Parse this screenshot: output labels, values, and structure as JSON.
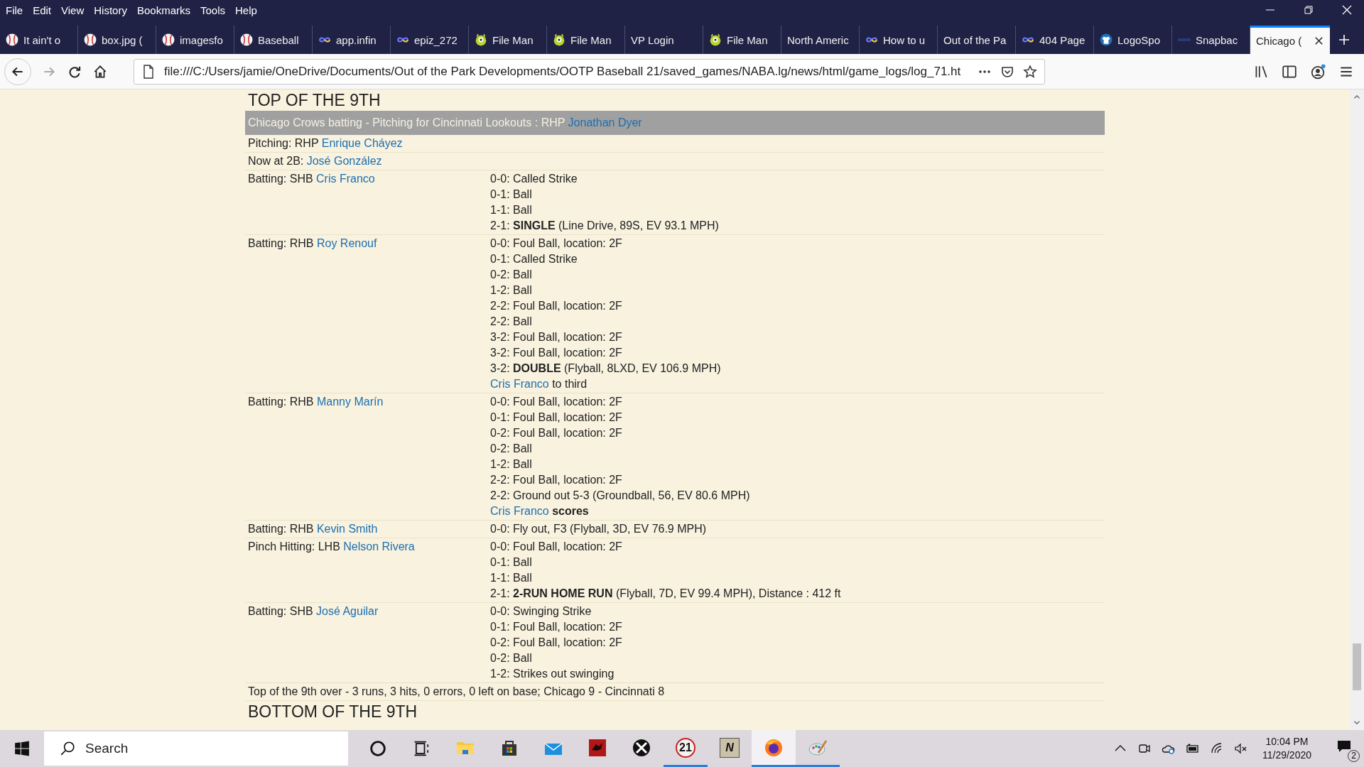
{
  "menu_bar": [
    "File",
    "Edit",
    "View",
    "History",
    "Bookmarks",
    "Tools",
    "Help"
  ],
  "tabs": [
    {
      "label": "It ain't o",
      "kind": "baseball",
      "selected": false
    },
    {
      "label": "box.jpg (",
      "kind": "baseball",
      "selected": false
    },
    {
      "label": "imagesfo",
      "kind": "baseball",
      "selected": false
    },
    {
      "label": "Baseball",
      "kind": "baseball",
      "selected": false
    },
    {
      "label": "app.infin",
      "kind": "infinity",
      "selected": false
    },
    {
      "label": "epiz_272",
      "kind": "infinity",
      "selected": false
    },
    {
      "label": "File Man",
      "kind": "monster",
      "selected": false
    },
    {
      "label": "File Man",
      "kind": "monster",
      "selected": false
    },
    {
      "label": "VP Login",
      "kind": "plain",
      "selected": false
    },
    {
      "label": "File Man",
      "kind": "monster",
      "selected": false
    },
    {
      "label": "North Americ",
      "kind": "plain",
      "selected": false
    },
    {
      "label": "How to u",
      "kind": "infinity",
      "selected": false
    },
    {
      "label": "Out of the Pa",
      "kind": "plain",
      "selected": false
    },
    {
      "label": "404 Page",
      "kind": "infinity",
      "selected": false
    },
    {
      "label": "LogoSpo",
      "kind": "shirt",
      "selected": false
    },
    {
      "label": "Snapbac",
      "kind": "snap",
      "selected": false
    },
    {
      "label": "Chicago (",
      "kind": "plain",
      "selected": true
    }
  ],
  "address_bar": {
    "url": "file:///C:/Users/jamie/OneDrive/Documents/Out of the Park Developments/OOTP Baseball 21/saved_games/NABA.lg/news/html/game_logs/log_71.ht"
  },
  "page": {
    "heading": "TOP OF THE 9TH",
    "banner": {
      "text": "Chicago Crows batting - Pitching for Cincinnati Lookouts : RHP",
      "player": "Jonathan Dyer"
    },
    "rows": [
      {
        "label": "Pitching: RHP",
        "player": "Enrique Cháyez",
        "events": []
      },
      {
        "label": "Now at 2B:",
        "player": "José González",
        "events": []
      },
      {
        "label": "Batting: SHB",
        "player": "Cris Franco",
        "events": [
          {
            "text": "0-0: Called Strike"
          },
          {
            "text": "0-1: Ball"
          },
          {
            "text": "1-1: Ball"
          },
          {
            "text": "2-1: **SINGLE** (Line Drive, 89S, EV 93.1 MPH)"
          }
        ]
      },
      {
        "label": "Batting: RHB",
        "player": "Roy Renouf",
        "events": [
          {
            "text": "0-0: Foul Ball, location: 2F"
          },
          {
            "text": "0-1: Called Strike"
          },
          {
            "text": "0-2: Ball"
          },
          {
            "text": "1-2: Ball"
          },
          {
            "text": "2-2: Foul Ball, location: 2F"
          },
          {
            "text": "2-2: Ball"
          },
          {
            "text": "3-2: Foul Ball, location: 2F"
          },
          {
            "text": "3-2: Foul Ball, location: 2F"
          },
          {
            "text": "3-2: **DOUBLE** (Flyball, 8LXD, EV 106.9 MPH)"
          },
          {
            "player": "Cris Franco",
            "text": "to third"
          }
        ]
      },
      {
        "label": "Batting: RHB",
        "player": "Manny Marín",
        "events": [
          {
            "text": "0-0: Foul Ball, location: 2F"
          },
          {
            "text": "0-1: Foul Ball, location: 2F"
          },
          {
            "text": "0-2: Foul Ball, location: 2F"
          },
          {
            "text": "0-2: Ball"
          },
          {
            "text": "1-2: Ball"
          },
          {
            "text": "2-2: Foul Ball, location: 2F"
          },
          {
            "text": "2-2: Ground out 5-3 (Groundball, 56, EV 80.6 MPH)"
          },
          {
            "player": "Cris Franco",
            "text": "**scores**"
          }
        ]
      },
      {
        "label": "Batting: RHB",
        "player": "Kevin Smith",
        "events": [
          {
            "text": "0-0: Fly out, F3 (Flyball, 3D, EV 76.9 MPH)"
          }
        ]
      },
      {
        "label": "Pinch Hitting: LHB",
        "player": "Nelson Rivera",
        "events": [
          {
            "text": "0-0: Foul Ball, location: 2F"
          },
          {
            "text": "0-1: Ball"
          },
          {
            "text": "1-1: Ball"
          },
          {
            "text": "2-1: **2-RUN HOME RUN** (Flyball, 7D, EV 99.4 MPH), Distance : 412 ft"
          }
        ]
      },
      {
        "label": "Batting: SHB",
        "player": "José Aguilar",
        "events": [
          {
            "text": "0-0: Swinging Strike"
          },
          {
            "text": "0-1: Foul Ball, location: 2F"
          },
          {
            "text": "0-2: Foul Ball, location: 2F"
          },
          {
            "text": "0-2: Ball"
          },
          {
            "text": "1-2: Strikes out swinging"
          }
        ]
      }
    ],
    "summary": "Top of the 9th over - 3 runs, 3 hits, 0 errors, 0 left on base; Chicago 9 - Cincinnati 8",
    "next_heading": "BOTTOM OF THE 9TH"
  },
  "taskbar": {
    "search": {
      "placeholder": "Search"
    },
    "apps": [
      {
        "kind": "folder",
        "running": false,
        "active": false
      },
      {
        "kind": "store",
        "running": false,
        "active": false
      },
      {
        "kind": "mail",
        "running": false,
        "active": false
      },
      {
        "kind": "dragon",
        "running": false,
        "active": false
      },
      {
        "kind": "xbox",
        "running": false,
        "active": false
      },
      {
        "kind": "badge",
        "label": "21",
        "running": true,
        "active": false
      },
      {
        "kind": "tile",
        "label": "N",
        "running": false,
        "active": false
      },
      {
        "kind": "firefox",
        "running": true,
        "active": true
      },
      {
        "kind": "palette",
        "running": true,
        "active": false
      }
    ],
    "time": "10:04 PM",
    "date": "11/29/2020",
    "notifications": "2"
  }
}
